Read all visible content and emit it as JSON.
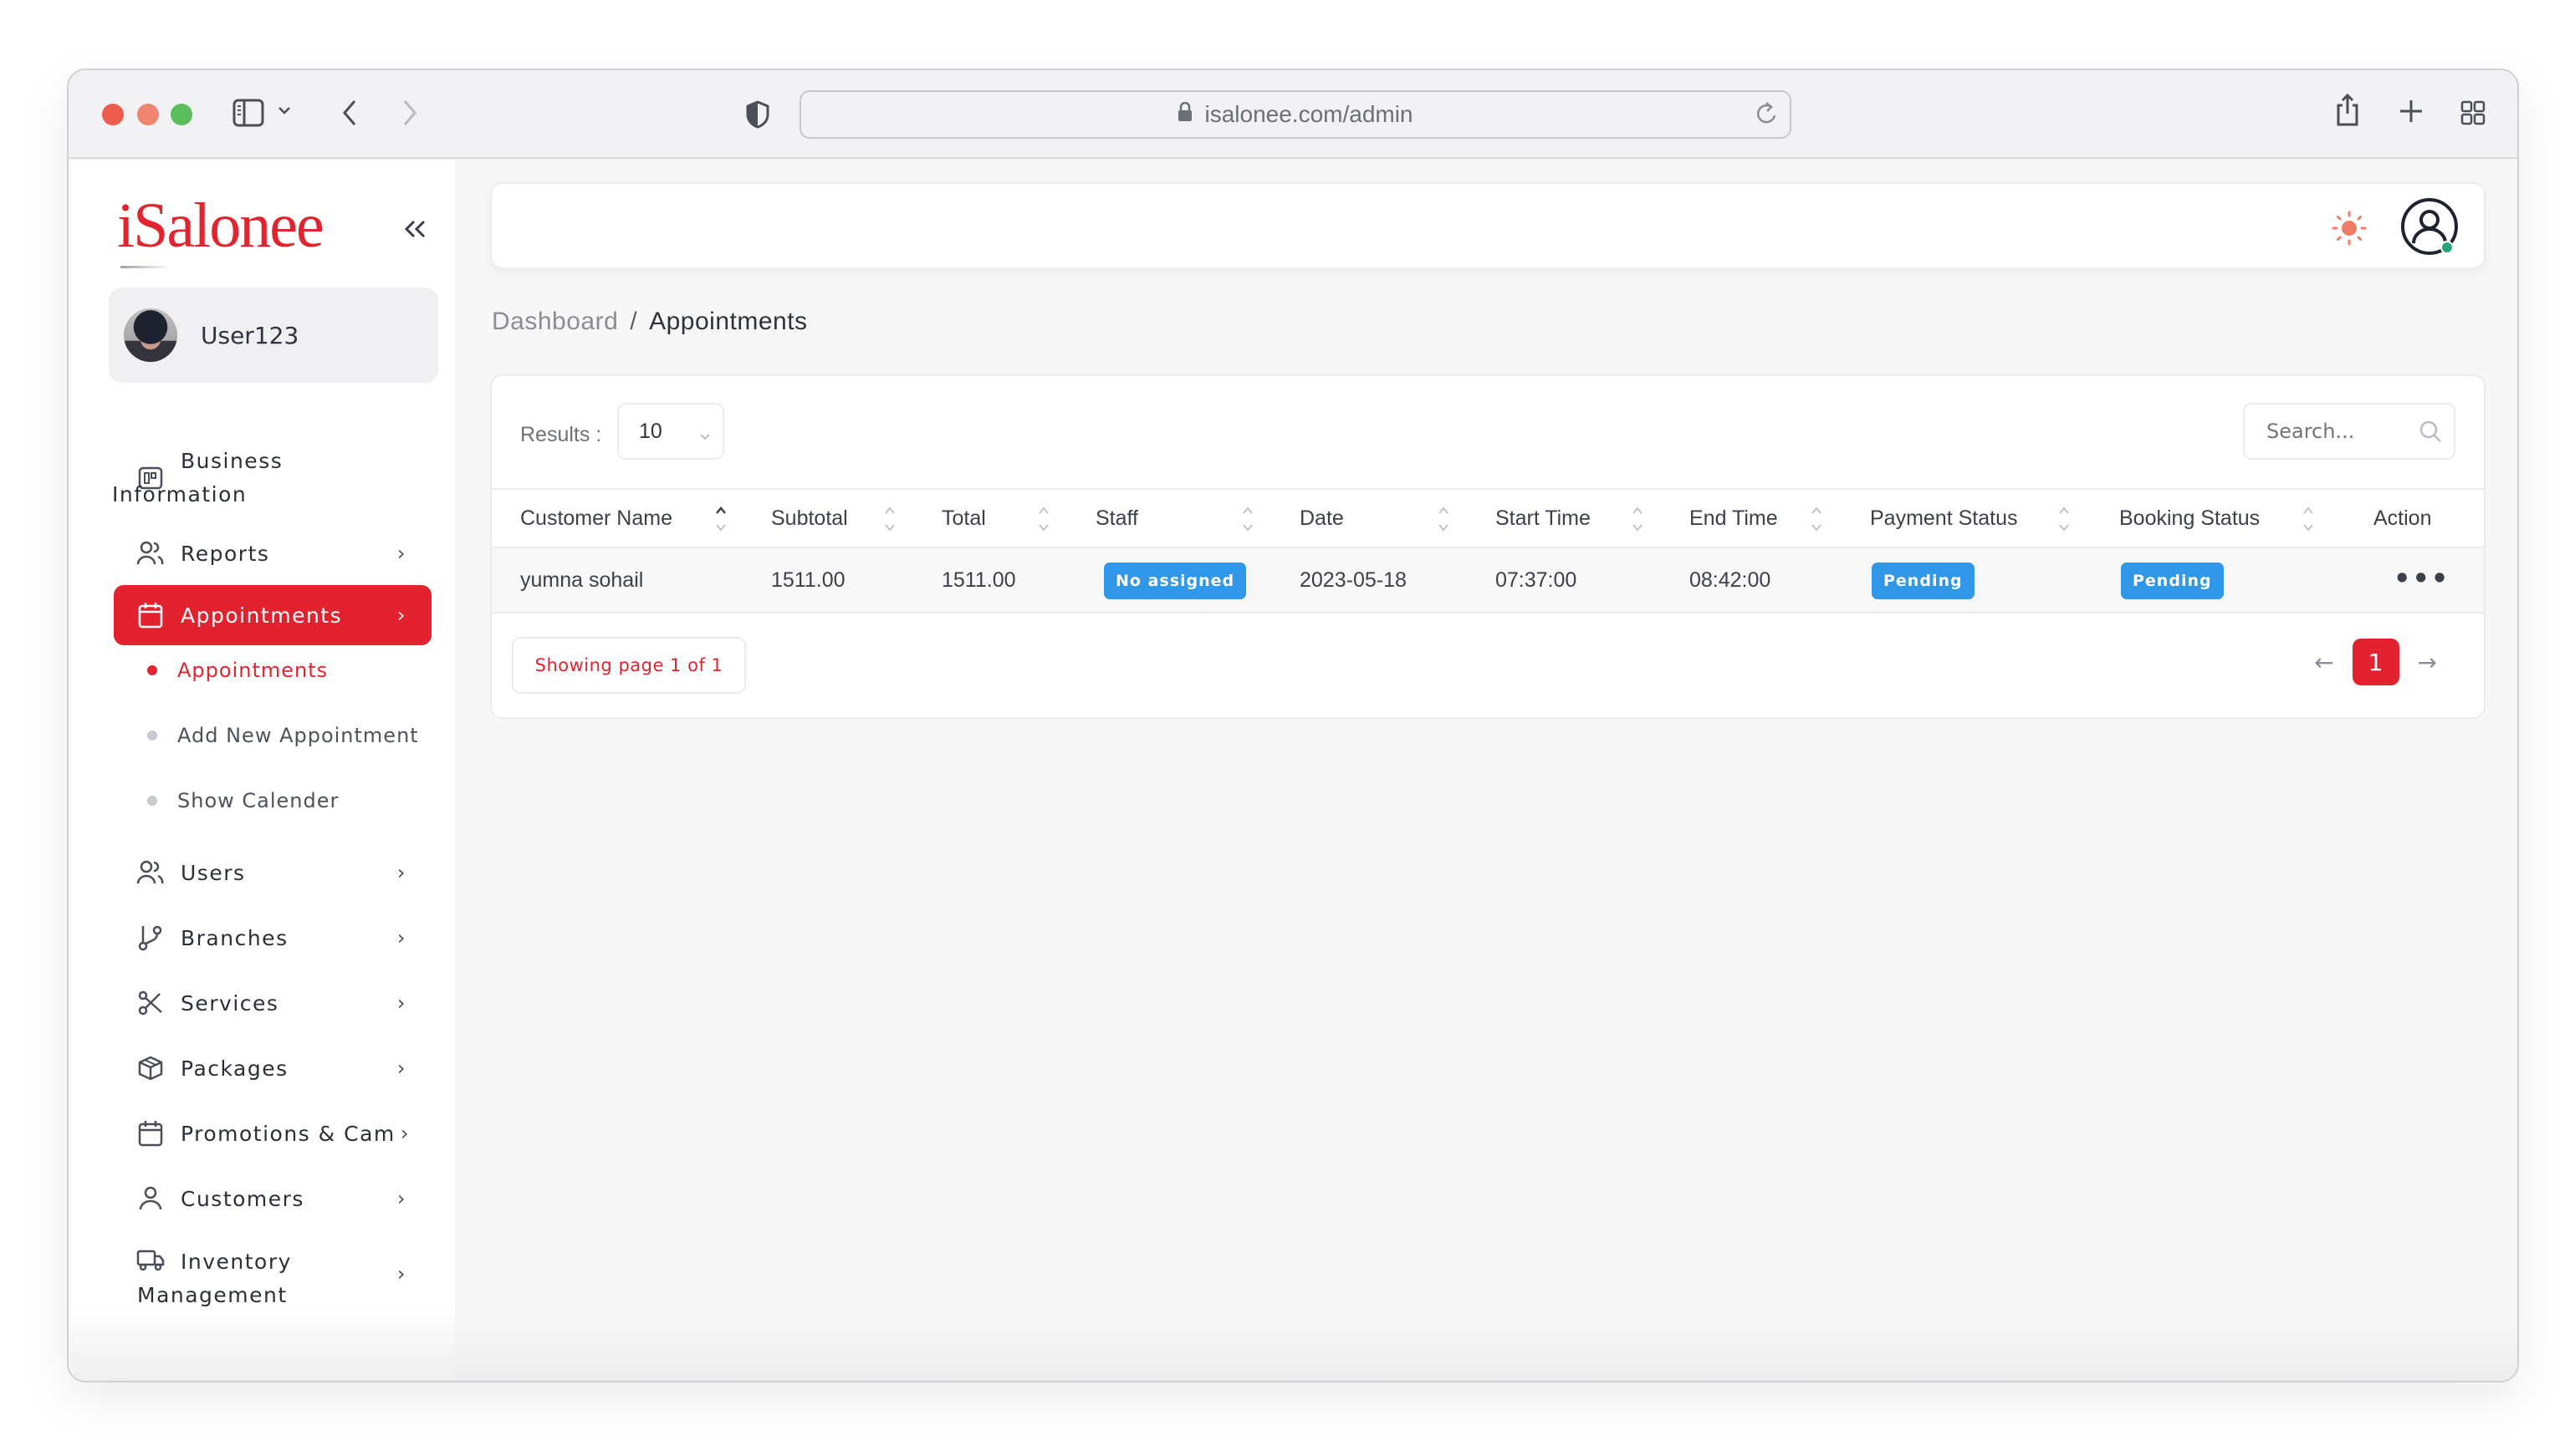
{
  "browser": {
    "url": "isalonee.com/admin"
  },
  "sidebar": {
    "logo": "iSalonee",
    "user": {
      "name": "User123"
    },
    "items": [
      {
        "label": "Business Information",
        "icon": "business-info-icon"
      },
      {
        "label": "Reports",
        "icon": "users-group-icon"
      },
      {
        "label": "Appointments",
        "icon": "calendar-icon",
        "active": true
      },
      {
        "label": "Users",
        "icon": "users-group-icon"
      },
      {
        "label": "Branches",
        "icon": "branch-icon"
      },
      {
        "label": "Services",
        "icon": "scissors-icon"
      },
      {
        "label": "Packages",
        "icon": "package-box-icon"
      },
      {
        "label": "Promotions & Camp",
        "icon": "calendar-icon"
      },
      {
        "label": "Customers",
        "icon": "user-icon"
      },
      {
        "label": "Inventory Management",
        "icon": "truck-icon"
      }
    ],
    "sub_items": [
      {
        "label": "Appointments",
        "active": true
      },
      {
        "label": "Add New Appointment"
      },
      {
        "label": "Show Calender"
      }
    ]
  },
  "header": {
    "theme_icon": "sun-icon",
    "profile_icon": "user-circle-icon"
  },
  "breadcrumb": {
    "parent": "Dashboard",
    "separator": "/",
    "current": "Appointments"
  },
  "table_controls": {
    "results_label": "Results :",
    "results_value": "10",
    "search_placeholder": "Search..."
  },
  "table": {
    "columns": [
      "Customer Name",
      "Subtotal",
      "Total",
      "Staff",
      "Date",
      "Start Time",
      "End Time",
      "Payment Status",
      "Booking Status",
      "Action"
    ],
    "rows": [
      {
        "customer_name": "yumna sohail",
        "subtotal": "1511.00",
        "total": "1511.00",
        "staff": "No assigned",
        "date": "2023-05-18",
        "start_time": "07:37:00",
        "end_time": "08:42:00",
        "payment_status": "Pending",
        "booking_status": "Pending",
        "action": "•••"
      }
    ]
  },
  "pagination": {
    "info": "Showing page 1 of 1",
    "current_page": "1",
    "prev": "←",
    "next": "→"
  },
  "colors": {
    "brand": "#e2222f",
    "badge": "#3097e9",
    "online": "#27a57a",
    "sun": "#ef7d68"
  }
}
